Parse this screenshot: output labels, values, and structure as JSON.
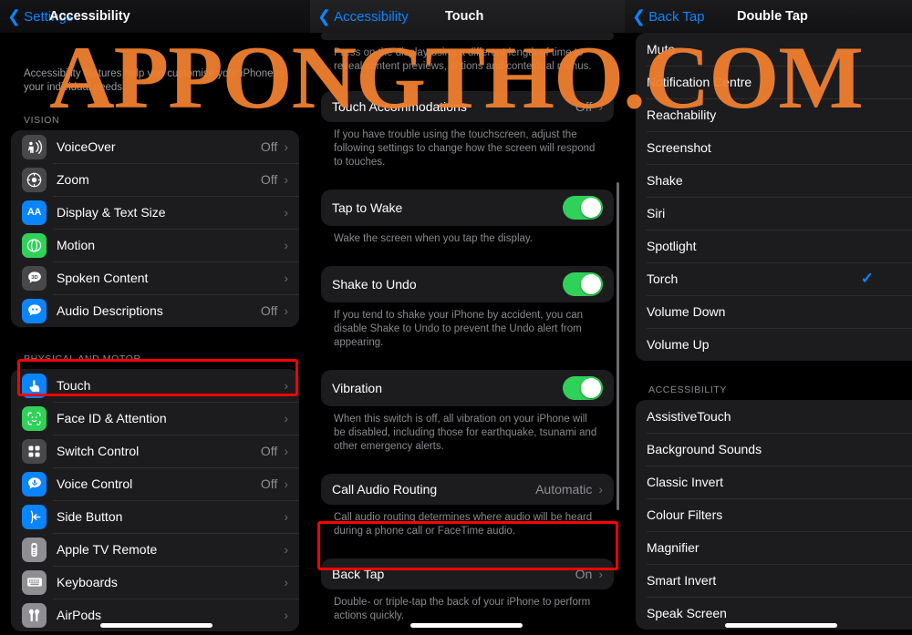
{
  "watermark": "APPONGTHO.COM",
  "colors": {
    "accent_blue": "#0a84ff",
    "toggle_green": "#30d158",
    "highlight_red": "#ff0000",
    "watermark_orange": "#f08030",
    "group_bg": "#1c1c1e",
    "page_bg": "#000000"
  },
  "panels": {
    "left": {
      "nav": {
        "back_label": "Settings",
        "title": "Accessibility"
      },
      "intro": "Accessibility features help you customise your iPhone to your individual needs.",
      "sections": [
        {
          "header": "VISION",
          "rows": [
            {
              "label": "VoiceOver",
              "value": "Off",
              "chevron": "›",
              "icon": "voiceover-icon"
            },
            {
              "label": "Zoom",
              "value": "Off",
              "chevron": "›",
              "icon": "zoom-icon"
            },
            {
              "label": "Display & Text Size",
              "value": "",
              "chevron": "›",
              "icon": "display-text-size-icon"
            },
            {
              "label": "Motion",
              "value": "",
              "chevron": "›",
              "icon": "motion-icon"
            },
            {
              "label": "Spoken Content",
              "value": "",
              "chevron": "›",
              "icon": "spoken-content-icon"
            },
            {
              "label": "Audio Descriptions",
              "value": "Off",
              "chevron": "›",
              "icon": "audio-descriptions-icon"
            }
          ]
        },
        {
          "header": "PHYSICAL AND MOTOR",
          "rows": [
            {
              "label": "Touch",
              "value": "",
              "chevron": "›",
              "icon": "touch-icon"
            },
            {
              "label": "Face ID & Attention",
              "value": "",
              "chevron": "›",
              "icon": "face-id-icon"
            },
            {
              "label": "Switch Control",
              "value": "Off",
              "chevron": "›",
              "icon": "switch-control-icon"
            },
            {
              "label": "Voice Control",
              "value": "Off",
              "chevron": "›",
              "icon": "voice-control-icon"
            },
            {
              "label": "Side Button",
              "value": "",
              "chevron": "›",
              "icon": "side-button-icon"
            },
            {
              "label": "Apple TV Remote",
              "value": "",
              "chevron": "›",
              "icon": "apple-tv-remote-icon"
            },
            {
              "label": "Keyboards",
              "value": "",
              "chevron": "›",
              "icon": "keyboards-icon"
            },
            {
              "label": "AirPods",
              "value": "",
              "chevron": "›",
              "icon": "airpods-icon"
            }
          ]
        }
      ]
    },
    "middle": {
      "nav": {
        "back_label": "Accessibility",
        "title": "Touch"
      },
      "haptic_footnote": "Press on the display using a different length of time to reveal content previews, actions and contextual menus.",
      "touch_accommodations": {
        "label": "Touch Accommodations",
        "value": "Off",
        "chevron": "›"
      },
      "touch_accommodations_footnote": "If you have trouble using the touchscreen, adjust the following settings to change how the screen will respond to touches.",
      "tap_to_wake": {
        "label": "Tap to Wake",
        "state": "on"
      },
      "tap_to_wake_footnote": "Wake the screen when you tap the display.",
      "shake_to_undo": {
        "label": "Shake to Undo",
        "state": "on"
      },
      "shake_to_undo_footnote": "If you tend to shake your iPhone by accident, you can disable Shake to Undo to prevent the Undo alert from appearing.",
      "vibration": {
        "label": "Vibration",
        "state": "on"
      },
      "vibration_footnote": "When this switch is off, all vibration on your iPhone will be disabled, including those for earthquake, tsunami and other emergency alerts.",
      "call_audio_routing": {
        "label": "Call Audio Routing",
        "value": "Automatic",
        "chevron": "›"
      },
      "call_audio_routing_footnote": "Call audio routing determines where audio will be heard during a phone call or FaceTime audio.",
      "back_tap": {
        "label": "Back Tap",
        "value": "On",
        "chevron": "›"
      },
      "back_tap_footnote": "Double- or triple-tap the back of your iPhone to perform actions quickly."
    },
    "right": {
      "nav": {
        "back_label": "Back Tap",
        "title": "Double Tap"
      },
      "system_rows": [
        {
          "label": "Mute",
          "selected": false
        },
        {
          "label": "Notification Centre",
          "selected": false
        },
        {
          "label": "Reachability",
          "selected": false
        },
        {
          "label": "Screenshot",
          "selected": false
        },
        {
          "label": "Shake",
          "selected": false
        },
        {
          "label": "Siri",
          "selected": false
        },
        {
          "label": "Spotlight",
          "selected": false
        },
        {
          "label": "Torch",
          "selected": true
        },
        {
          "label": "Volume Down",
          "selected": false
        },
        {
          "label": "Volume Up",
          "selected": false
        }
      ],
      "accessibility_header": "ACCESSIBILITY",
      "accessibility_rows": [
        {
          "label": "AssistiveTouch",
          "selected": false
        },
        {
          "label": "Background Sounds",
          "selected": false
        },
        {
          "label": "Classic Invert",
          "selected": false
        },
        {
          "label": "Colour Filters",
          "selected": false
        },
        {
          "label": "Magnifier",
          "selected": false
        },
        {
          "label": "Smart Invert",
          "selected": false
        },
        {
          "label": "Speak Screen",
          "selected": false
        }
      ],
      "checkmark_glyph": "✓"
    }
  }
}
